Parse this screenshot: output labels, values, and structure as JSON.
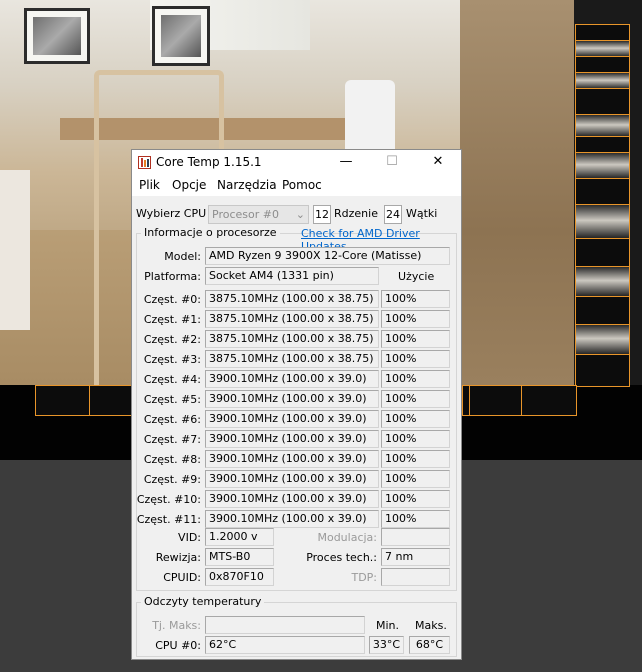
{
  "window": {
    "title": "Core Temp 1.15.1",
    "minimize_glyph": "—",
    "maximize_glyph": "☐",
    "close_glyph": "✕"
  },
  "menu": [
    "Plik",
    "Opcje",
    "Narzędzia",
    "Pomoc"
  ],
  "cpu_select": {
    "label": "Wybierz CPU",
    "value": "Procesor #0",
    "cores_value": "12",
    "cores_label": "Rdzenie",
    "threads_value": "24",
    "threads_label": "Wątki"
  },
  "info": {
    "group_title": "Informacje o procesorze",
    "driver_link": "Check for AMD Driver Updates",
    "model_label": "Model:",
    "model_value": "AMD Ryzen 9 3900X 12-Core (Matisse)",
    "platform_label": "Platforma:",
    "platform_value": "Socket AM4 (1331 pin)",
    "usage_header": "Użycie",
    "freq_rows": [
      {
        "label": "Częst. #0:",
        "value": "3875.10MHz (100.00 x 38.75)",
        "usage": "100%"
      },
      {
        "label": "Częst. #1:",
        "value": "3875.10MHz (100.00 x 38.75)",
        "usage": "100%"
      },
      {
        "label": "Częst. #2:",
        "value": "3875.10MHz (100.00 x 38.75)",
        "usage": "100%"
      },
      {
        "label": "Częst. #3:",
        "value": "3875.10MHz (100.00 x 38.75)",
        "usage": "100%"
      },
      {
        "label": "Częst. #4:",
        "value": "3900.10MHz (100.00 x 39.0)",
        "usage": "100%"
      },
      {
        "label": "Częst. #5:",
        "value": "3900.10MHz (100.00 x 39.0)",
        "usage": "100%"
      },
      {
        "label": "Częst. #6:",
        "value": "3900.10MHz (100.00 x 39.0)",
        "usage": "100%"
      },
      {
        "label": "Częst. #7:",
        "value": "3900.10MHz (100.00 x 39.0)",
        "usage": "100%"
      },
      {
        "label": "Częst. #8:",
        "value": "3900.10MHz (100.00 x 39.0)",
        "usage": "100%"
      },
      {
        "label": "Częst. #9:",
        "value": "3900.10MHz (100.00 x 39.0)",
        "usage": "100%"
      },
      {
        "label": "Częst. #10:",
        "value": "3900.10MHz (100.00 x 39.0)",
        "usage": "100%"
      },
      {
        "label": "Częst. #11:",
        "value": "3900.10MHz (100.00 x 39.0)",
        "usage": "100%"
      }
    ],
    "vid_label": "VID:",
    "vid_value": "1.2000 v",
    "modulation_label": "Modulacja:",
    "modulation_value": "",
    "revision_label": "Rewizja:",
    "revision_value": "MTS-B0",
    "process_label": "Proces tech.:",
    "process_value": "7 nm",
    "cpuid_label": "CPUID:",
    "cpuid_value": "0x870F10",
    "tdp_label": "TDP:",
    "tdp_value": ""
  },
  "temps": {
    "group_title": "Odczyty temperatury",
    "tjmax_label": "Tj. Maks:",
    "tjmax_value": "",
    "min_header": "Min.",
    "max_header": "Maks.",
    "cpu_label": "CPU #0:",
    "cpu_value": "62°C",
    "cpu_min": "33°C",
    "cpu_max": "68°C"
  },
  "colors": {
    "accent_border": "#e8952a",
    "link": "#0066cc"
  },
  "icons": {
    "app": "core-temp-icon"
  }
}
